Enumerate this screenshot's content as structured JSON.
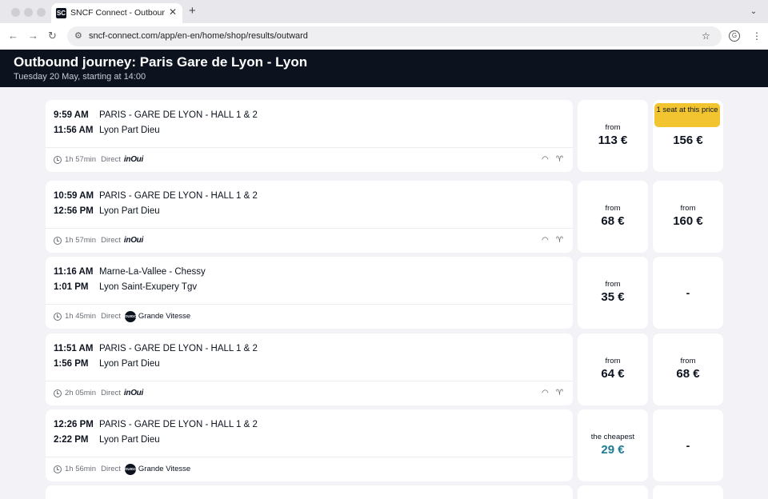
{
  "browser": {
    "tab_title": "SNCF Connect - Outbound journey",
    "tab_favicon": "SC",
    "url": "sncf-connect.com/app/en-en/home/shop/results/outward",
    "icons": {
      "back": "arrow-left-icon",
      "forward": "arrow-right-icon",
      "reload": "reload-icon",
      "site_info": "tune-icon",
      "bookmark": "star-icon",
      "profile": "profile-icon",
      "menu": "more-vertical-icon",
      "new_tab": "plus-icon",
      "tab_list": "chevron-down-icon"
    }
  },
  "header": {
    "title": "Outbound journey: Paris Gare de Lyon - Lyon",
    "subtitle": "Tuesday 20 May, starting at 14:00",
    "background": "#0c131f"
  },
  "journeys": [
    {
      "depart_time": "9:59 AM",
      "depart_station": "PARIS - GARE DE LYON - HALL 1 & 2",
      "arrive_time": "11:56 AM",
      "arrive_station": "Lyon Part Dieu",
      "duration": "1h 57min",
      "direct": "Direct",
      "brand": "inOui",
      "amenities": [
        "wifi-icon",
        "bar-icon"
      ],
      "second_class": {
        "label": "from",
        "price": "113 €"
      },
      "first_class": {
        "badge": "1 seat at this price",
        "price": "156 €"
      }
    },
    {
      "depart_time": "10:59 AM",
      "depart_station": "PARIS - GARE DE LYON - HALL 1 & 2",
      "arrive_time": "12:56 PM",
      "arrive_station": "Lyon Part Dieu",
      "duration": "1h 57min",
      "direct": "Direct",
      "brand": "inOui",
      "amenities": [
        "wifi-icon",
        "bar-icon"
      ],
      "second_class": {
        "label": "from",
        "price": "68 €"
      },
      "first_class": {
        "label": "from",
        "price": "160 €"
      }
    },
    {
      "depart_time": "11:16 AM",
      "depart_station": "Marne-La-Vallee - Chessy",
      "arrive_time": "1:01 PM",
      "arrive_station": "Lyon Saint-Exupery Tgv",
      "duration": "1h 45min",
      "direct": "Direct",
      "brand": "Grande Vitesse",
      "brand_logo": "OUIGO",
      "amenities": [],
      "second_class": {
        "label": "from",
        "price": "35 €"
      },
      "first_class": {
        "price": "-"
      }
    },
    {
      "depart_time": "11:51 AM",
      "depart_station": "PARIS - GARE DE LYON - HALL 1 & 2",
      "arrive_time": "1:56 PM",
      "arrive_station": "Lyon Part Dieu",
      "duration": "2h 05min",
      "direct": "Direct",
      "brand": "inOui",
      "amenities": [
        "wifi-icon",
        "bar-icon"
      ],
      "second_class": {
        "label": "from",
        "price": "64 €"
      },
      "first_class": {
        "label": "from",
        "price": "68 €"
      }
    },
    {
      "depart_time": "12:26 PM",
      "depart_station": "PARIS - GARE DE LYON - HALL 1 & 2",
      "arrive_time": "2:22 PM",
      "arrive_station": "Lyon Part Dieu",
      "duration": "1h 56min",
      "direct": "Direct",
      "brand": "Grande Vitesse",
      "brand_logo": "OUIGO",
      "amenities": [],
      "second_class": {
        "label": "the cheapest",
        "price": "29 €",
        "price_color": "#1d7b94"
      },
      "first_class": {
        "price": "-"
      }
    }
  ],
  "colors": {
    "page_bg": "#f3f3f7",
    "badge": "#f2c530",
    "text": "#0c131f"
  }
}
